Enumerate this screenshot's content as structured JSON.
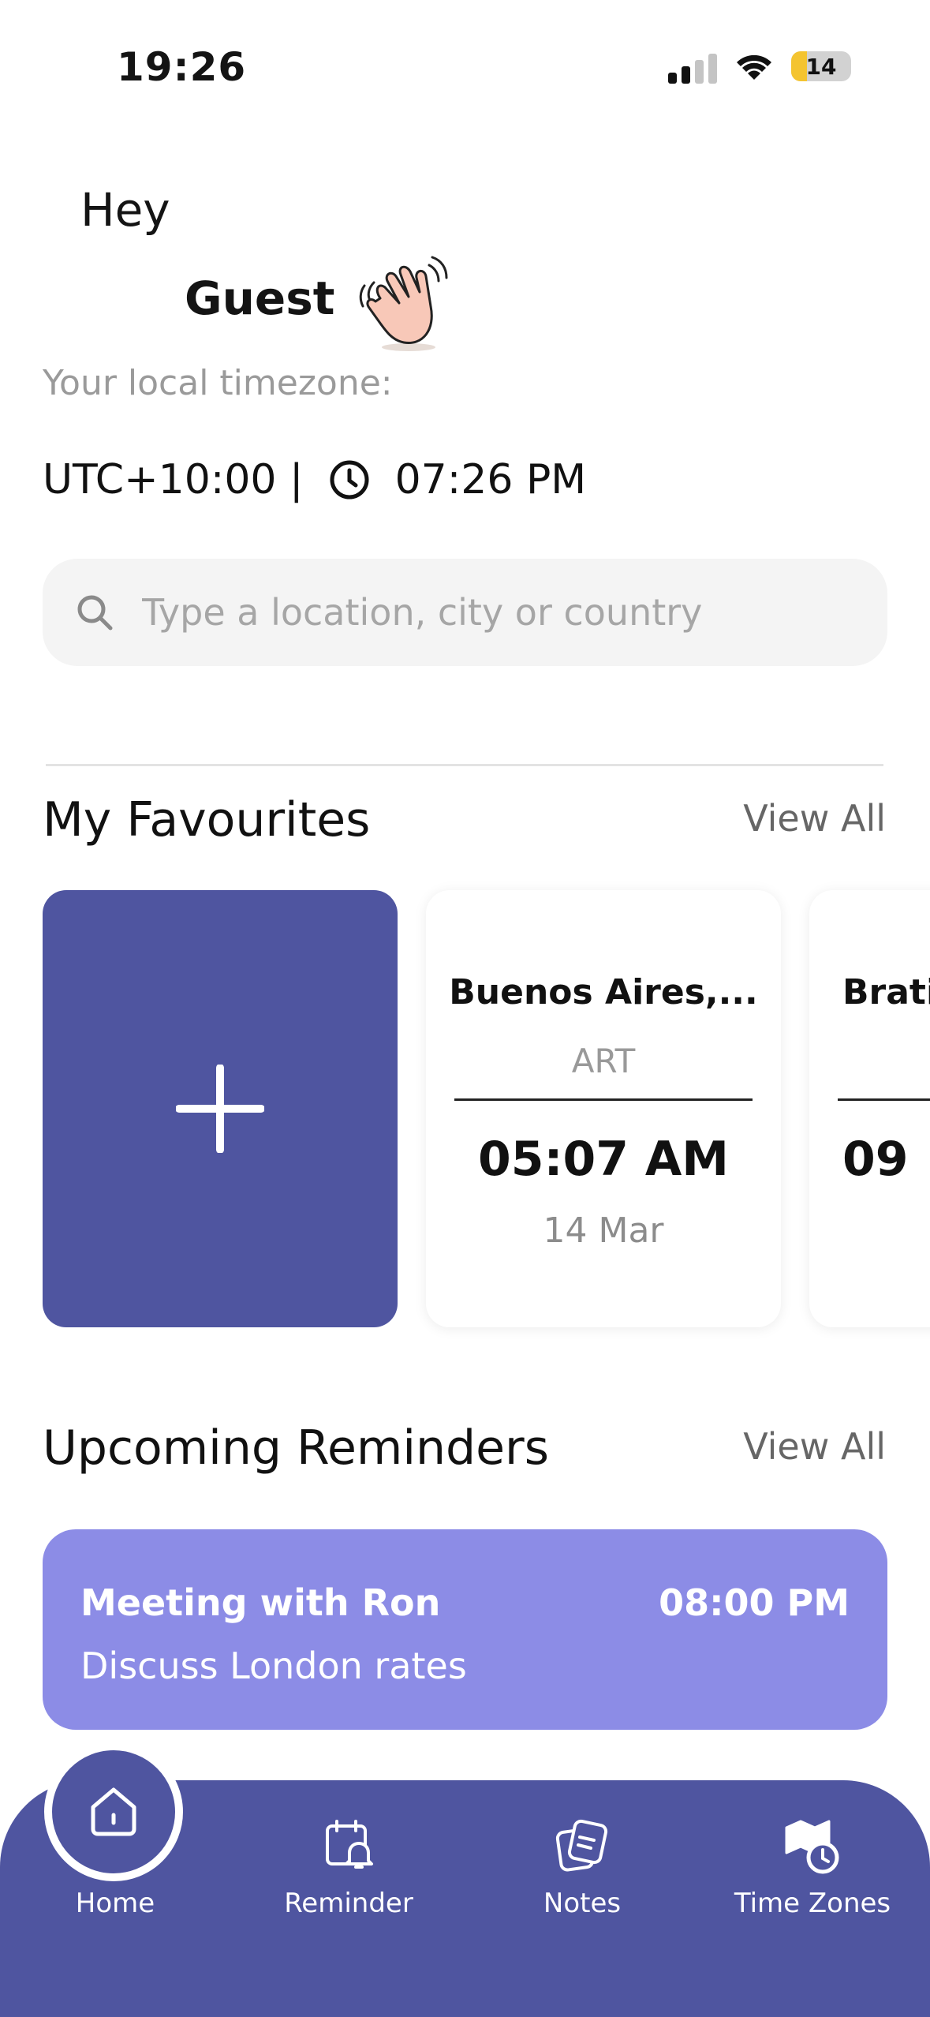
{
  "status_bar": {
    "time": "19:26",
    "battery": "14",
    "signal_icon": "cellular-signal-icon",
    "wifi_icon": "wifi-icon"
  },
  "greeting": {
    "hey": "Hey",
    "name": "Guest",
    "emoji_icon": "waving-hand-icon"
  },
  "local_timezone": {
    "label": "Your local timezone:",
    "utc": "UTC+10:00 |",
    "time": "07:26 PM",
    "icon": "clock-icon"
  },
  "search": {
    "placeholder": "Type a location, city or country",
    "value": "",
    "icon": "search-icon"
  },
  "favourites": {
    "title": "My Favourites",
    "view_all": "View All",
    "add_icon": "plus-icon",
    "cards": [
      {
        "city": "Buenos Aires,...",
        "abbr": "ART",
        "time": "05:07 AM",
        "date": "14 Mar"
      },
      {
        "city": "Brati",
        "abbr": "",
        "time": "09",
        "date": ""
      }
    ]
  },
  "reminders": {
    "title": "Upcoming Reminders",
    "view_all": "View All",
    "items": [
      {
        "title": "Meeting with Ron",
        "time": "08:00 PM",
        "description": "Discuss London rates"
      }
    ]
  },
  "bottom_nav": {
    "items": [
      {
        "label": "Home",
        "icon": "home-icon",
        "active": true
      },
      {
        "label": "Reminder",
        "icon": "calendar-bell-icon"
      },
      {
        "label": "Notes",
        "icon": "notes-icon"
      },
      {
        "label": "Time Zones",
        "icon": "map-clock-icon"
      }
    ]
  },
  "colors": {
    "primary": "#4f55a0",
    "reminder_card": "#8c8ce6",
    "search_bg": "#f4f4f4"
  }
}
